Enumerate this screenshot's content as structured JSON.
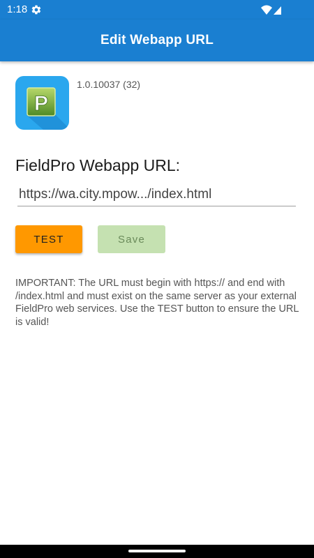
{
  "status_bar": {
    "time": "1:18",
    "icons": [
      "gear-icon",
      "wifi-icon",
      "signal-icon"
    ]
  },
  "app_bar": {
    "title": "Edit Webapp URL",
    "color": "#1a7fd1"
  },
  "app_info": {
    "icon": "fieldpro-logo",
    "icon_letter": "P",
    "version": "1.0.10037 (32)"
  },
  "form": {
    "url_label": "FieldPro Webapp URL:",
    "url_value": "https://wa.city.mpow.../index.html",
    "test_label": "TEST",
    "save_label": "Save"
  },
  "notice": {
    "text": "IMPORTANT: The URL must begin with https:// and end with /index.html and must exist on the same server as your external FieldPro web services. Use the TEST button to ensure the URL is valid!"
  },
  "colors": {
    "accent": "#1a7fd1",
    "test_button": "#ff9800",
    "save_button_disabled": "#c5e1b1"
  }
}
